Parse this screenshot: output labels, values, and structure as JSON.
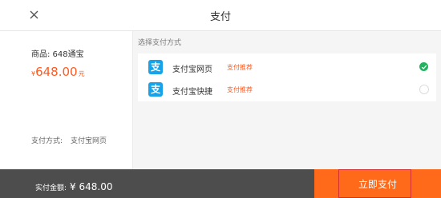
{
  "header": {
    "title": "支付",
    "close_icon": "close-icon"
  },
  "order": {
    "product_label": "商品: 648通宝",
    "price_symbol": "¥",
    "price_value": "648.00",
    "price_unit": "元",
    "method_label": "支付方式:",
    "method_value": "支付宝网页"
  },
  "payment": {
    "choose_label": "选择支付方式",
    "options": [
      {
        "name": "支付宝网页",
        "tag": "支付推荐",
        "icon": "alipay-icon",
        "selected": true
      },
      {
        "name": "支付宝快捷",
        "tag": "支付推荐",
        "icon": "alipay-icon",
        "selected": false
      }
    ],
    "icon_glyph": "支"
  },
  "footer": {
    "total_label": "实付金额:",
    "total_value": "¥ 648.00",
    "pay_button": "立即支付"
  },
  "colors": {
    "accent": "#ff6a1a",
    "price": "#ff5a1f",
    "alipay": "#16a3ea",
    "check": "#22b35e",
    "footer_bg": "#4d4d4d"
  }
}
